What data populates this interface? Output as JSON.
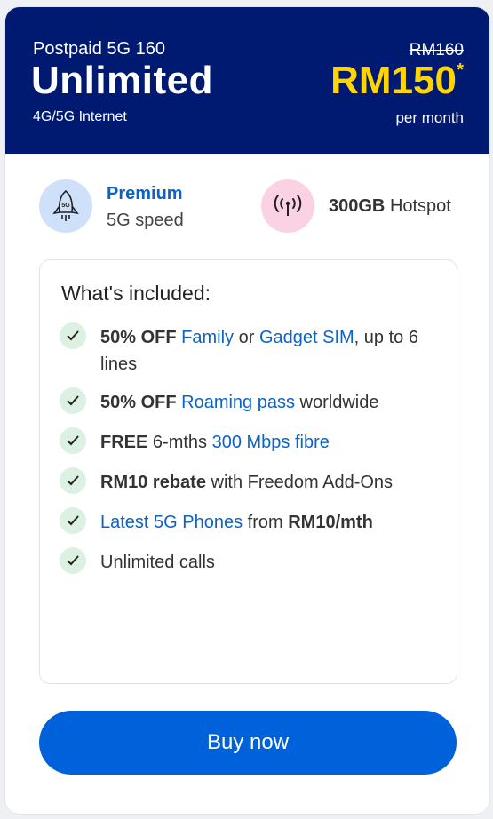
{
  "plan": {
    "name": "Postpaid 5G 160",
    "title": "Unlimited",
    "subtitle": "4G/5G Internet",
    "old_price": "RM160",
    "price": "RM150",
    "asterisk": "*",
    "period": "per month"
  },
  "features": {
    "speed": {
      "icon": "rocket-5g-icon",
      "title": "Premium",
      "subtitle": "5G speed"
    },
    "hotspot": {
      "icon": "hotspot-signal-icon",
      "amount": "300GB",
      "label": "Hotspot"
    }
  },
  "included": {
    "title": "What's included:",
    "items": [
      {
        "bold": "50% OFF",
        "link1": "Family",
        "mid": "or",
        "link2": "Gadget SIM",
        "rest": ", up to 6 lines"
      },
      {
        "bold": "50% OFF",
        "link": "Roaming pass",
        "rest": "worldwide"
      },
      {
        "bold": "FREE",
        "mid": "6-mths",
        "link": "300 Mbps fibre"
      },
      {
        "bold": "RM10 rebate",
        "rest": "with Freedom Add-Ons"
      },
      {
        "link": "Latest 5G Phones",
        "mid": "from",
        "bold": "RM10/mth"
      },
      {
        "text": "Unlimited calls"
      }
    ]
  },
  "buy_button": {
    "label": "Buy now"
  },
  "colors": {
    "header_bg": "#001a72",
    "price": "#ffd400",
    "link": "#0a63c9",
    "button": "#0062db",
    "check_bg": "#dcf1e2"
  }
}
